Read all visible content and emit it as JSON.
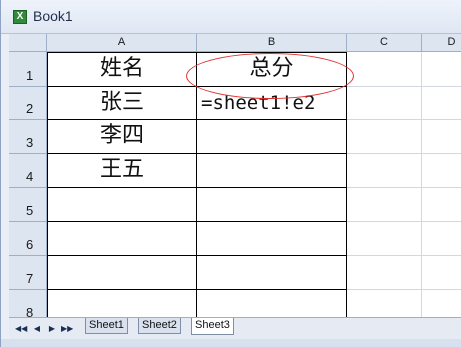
{
  "window": {
    "title": "Book1",
    "app_icon": "excel-icon"
  },
  "columns": [
    "A",
    "B",
    "C",
    "D"
  ],
  "rows": [
    "1",
    "2",
    "3",
    "4",
    "5",
    "6",
    "7",
    "8"
  ],
  "cells": {
    "A1": "姓名",
    "B1": "总分",
    "A2": "张三",
    "B2": "=sheet1!e2",
    "A3": "李四",
    "A4": "王五"
  },
  "annotation": {
    "color": "#e03030",
    "target": "B2"
  },
  "sheet_nav": {
    "first": "◀◀",
    "prev": "◀",
    "next": "▶",
    "last": "▶▶"
  },
  "sheets": [
    "Sheet1",
    "Sheet2",
    "Sheet3"
  ],
  "active_sheet": "Sheet3"
}
